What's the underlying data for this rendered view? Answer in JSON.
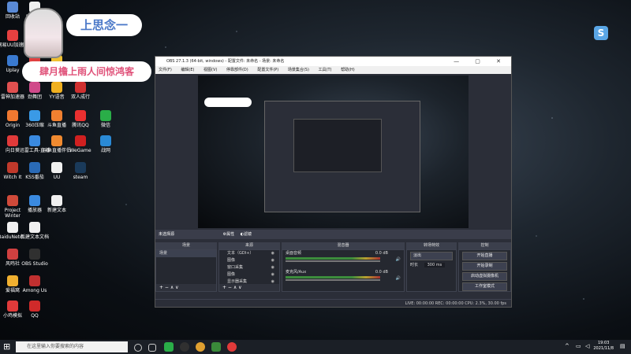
{
  "desktop": {
    "icons": [
      {
        "label": "回收站",
        "color": "#5a8ad6"
      },
      {
        "label": "Draw & Guess",
        "color": "#f0f0f0"
      },
      {
        "label": "网易UU加速器",
        "color": "#e64040"
      },
      {
        "label": "网易云游戏",
        "color": "#d03030"
      },
      {
        "label": "Uplay",
        "color": "#3a7ad0"
      },
      {
        "label": "加速器",
        "color": "#e04040"
      },
      {
        "label": "YY语音",
        "color": "#f0c030"
      },
      {
        "label": "雷神加速器",
        "color": "#e05050"
      },
      {
        "label": "劲舞团",
        "color": "#d04a8a"
      },
      {
        "label": "YY语音",
        "color": "#f0b020"
      },
      {
        "label": "双人成行",
        "color": "#d03030"
      },
      {
        "label": "Origin",
        "color": "#f07830"
      },
      {
        "label": "360压缩",
        "color": "#3a9ae6"
      },
      {
        "label": "斗鱼直播",
        "color": "#f08030"
      },
      {
        "label": "腾讯QQ",
        "color": "#ea3030"
      },
      {
        "label": "微信",
        "color": "#2aae48"
      },
      {
        "label": "向日葵",
        "color": "#e03a3a"
      },
      {
        "label": "迅雷工具-直播",
        "color": "#3a8ae0"
      },
      {
        "label": "斗鱼直播伴侣",
        "color": "#f08a30"
      },
      {
        "label": "WeGame",
        "color": "#d02020"
      },
      {
        "label": "战网",
        "color": "#2a8ad6"
      },
      {
        "label": "Witch It",
        "color": "#c0392b"
      },
      {
        "label": "KSS番茄",
        "color": "#2a6ab6"
      },
      {
        "label": "UU",
        "color": "#f0f0f0"
      },
      {
        "label": "steam",
        "color": "#1a3a5a"
      },
      {
        "label": "Project Winter",
        "color": "#d04a3a"
      },
      {
        "label": "播放器",
        "color": "#3a8ae0"
      },
      {
        "label": "新建文本",
        "color": "#f0f0f0"
      },
      {
        "label": "BaiduNetd...",
        "color": "#f0f0f0"
      },
      {
        "label": "新建文本文档",
        "color": "#f0f0f0"
      },
      {
        "label": "风鸣社",
        "color": "#d04040"
      },
      {
        "label": "OBS Studio",
        "color": "#303030"
      },
      {
        "label": "爱福窝",
        "color": "#f0b030"
      },
      {
        "label": "Among Us",
        "color": "#c03030"
      },
      {
        "label": "小鸡模拟",
        "color": "#e03a3a"
      },
      {
        "label": "QQ",
        "color": "#d02a2a"
      }
    ],
    "banner": {
      "name": "上思念一",
      "slogan": "肆月檐上雨人间惊鸿客"
    }
  },
  "obs": {
    "title": "OBS 27.1.3 (64-bit, windows) - 配置文件: 未命名 - 场景: 未命名",
    "window_controls": "— ▢ ✕",
    "menu": [
      "文件(F)",
      "编辑(E)",
      "视图(V)",
      "停靠部件(D)",
      "配置文件(P)",
      "场景集合(S)",
      "工具(T)",
      "帮助(H)"
    ],
    "no_source": "未选择源",
    "props_btn": "⚙属性",
    "filters_btn": "◐滤镜",
    "panels": {
      "scenes": "场景",
      "sources": "来源",
      "mixer": "混音器",
      "transitions": "转场特效",
      "controls": "控制"
    },
    "scene_item": "场景",
    "sources": [
      "文本（GDI+）",
      "图像",
      "窗口采集",
      "图像",
      "音频",
      "显示器采集"
    ],
    "mixer": [
      {
        "name": "桌面音频",
        "db": "0.0 dB"
      },
      {
        "name": "麦克风/Aux",
        "db": "0.0 dB"
      }
    ],
    "transition": {
      "type": "淡出",
      "duration_label": "时长",
      "duration": "300 ms"
    },
    "controls": [
      "开始直播",
      "开始录制",
      "启动虚拟摄像机",
      "工作室模式",
      "设置",
      "退出"
    ],
    "status": "LIVE: 00:00:00   REC: 00:00:00   CPU: 2.3%, 30.00 fps",
    "foot_symbols": "+ − ∧ ∨"
  },
  "taskbar": {
    "search_placeholder": "在这里输入你要搜索的内容",
    "time": "19:03",
    "date": "2021/11/8"
  },
  "colors": {
    "accent": "#4a78c8",
    "pink": "#e0527a"
  }
}
